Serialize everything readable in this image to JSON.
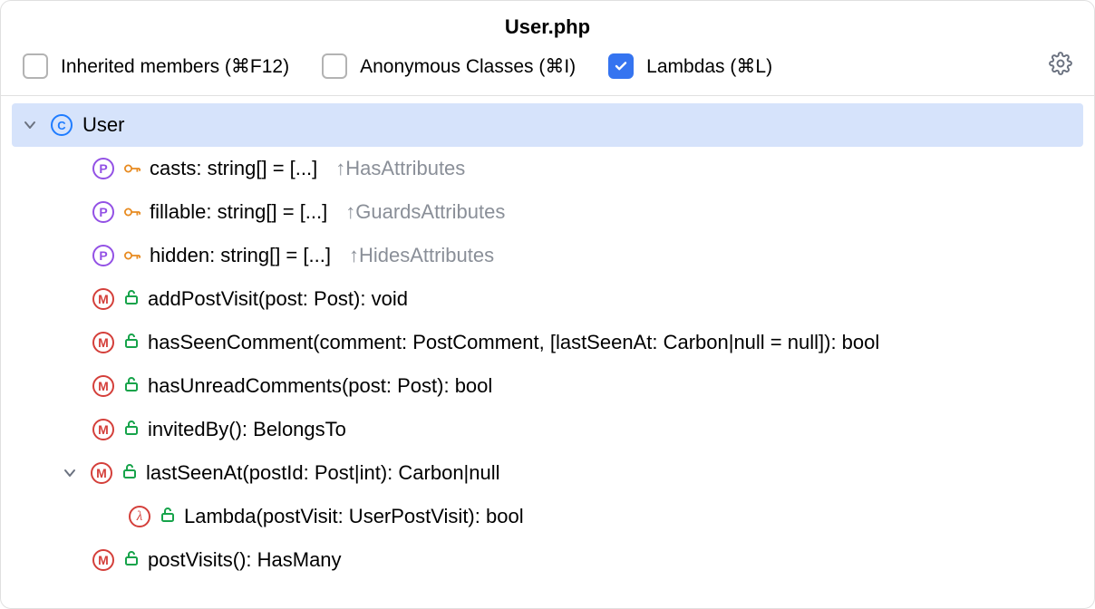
{
  "title": "User.php",
  "toolbar": {
    "inherited_label": "Inherited members (⌘F12)",
    "anonymous_label": "Anonymous Classes (⌘I)",
    "lambdas_label": "Lambdas (⌘L)",
    "inherited_checked": false,
    "anonymous_checked": false,
    "lambdas_checked": true
  },
  "tree": {
    "class_name": "User",
    "items": [
      {
        "kind": "property",
        "sig": "casts: string[] = [...]",
        "annot": "HasAttributes"
      },
      {
        "kind": "property",
        "sig": "fillable: string[] = [...]",
        "annot": "GuardsAttributes"
      },
      {
        "kind": "property",
        "sig": "hidden: string[] = [...]",
        "annot": "HidesAttributes"
      },
      {
        "kind": "method",
        "sig": "addPostVisit(post: Post): void"
      },
      {
        "kind": "method",
        "sig": "hasSeenComment(comment: PostComment, [lastSeenAt: Carbon|null = null]): bool"
      },
      {
        "kind": "method",
        "sig": "hasUnreadComments(post: Post): bool"
      },
      {
        "kind": "method",
        "sig": "invitedBy(): BelongsTo"
      },
      {
        "kind": "method",
        "sig": "lastSeenAt(postId: Post|int): Carbon|null",
        "expanded": true,
        "children": [
          {
            "kind": "lambda",
            "sig": "Lambda(postVisit: UserPostVisit): bool"
          }
        ]
      },
      {
        "kind": "method",
        "sig": "postVisits(): HasMany"
      }
    ]
  }
}
